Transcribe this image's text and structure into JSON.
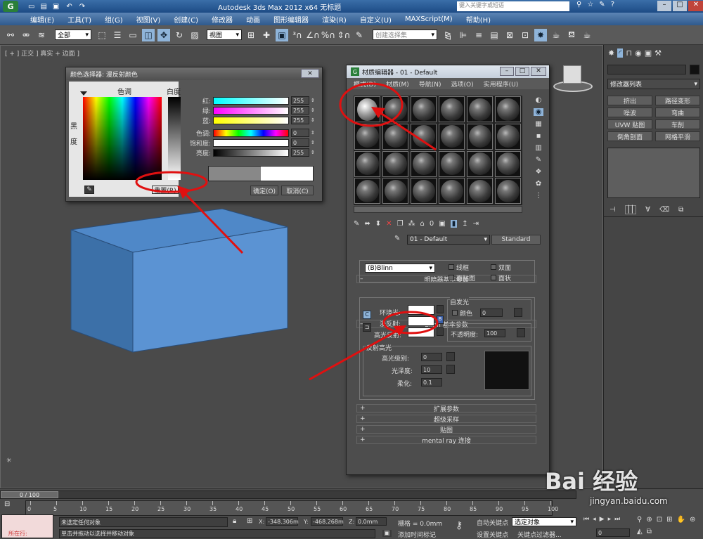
{
  "app": {
    "title": "Autodesk 3ds Max  2012 x64     无标题",
    "search_placeholder": "键入关键字或短语"
  },
  "menu": [
    "编辑(E)",
    "工具(T)",
    "组(G)",
    "视图(V)",
    "创建(C)",
    "修改器",
    "动画",
    "图形编辑器",
    "渲染(R)",
    "自定义(U)",
    "MAXScript(M)",
    "帮助(H)"
  ],
  "toolbar": {
    "filter": "全部",
    "view": "视图",
    "selection_set": "创建选择集"
  },
  "viewport": {
    "label": "[ + ] 正交 ] 真实 + 边面 ]"
  },
  "color_picker": {
    "title": "颜色选择器: 漫反射颜色",
    "hue_label": "色调",
    "white_label": "白度",
    "black_label": "黑\n度",
    "reset": "重置(R)",
    "ok": "确定(O)",
    "cancel": "取消(C)",
    "channels": [
      {
        "label": "红:",
        "value": "255",
        "color": "#f2f2ff"
      },
      {
        "label": "绿:",
        "value": "255",
        "color": "#ff60ff"
      },
      {
        "label": "蓝:",
        "value": "255",
        "color": "#ffff60"
      },
      {
        "label": "色调:",
        "value": "0"
      },
      {
        "label": "饱和度:",
        "value": "0"
      },
      {
        "label": "亮度:",
        "value": "255"
      }
    ]
  },
  "mat_editor": {
    "title": "材质编辑器 - 01 - Default",
    "menu": [
      "模式(D)",
      "材质(M)",
      "导航(N)",
      "选项(O)",
      "实用程序(U)"
    ],
    "mat_name": "01 - Default",
    "mat_type": "Standard",
    "shader_rollout": "明暗器基本参数",
    "shader": "(B)Blinn",
    "wire": "线框",
    "two_sided": "双面",
    "face_map": "面贴图",
    "faceted": "面状",
    "blinn_rollout": "Blinn 基本参数",
    "ambient": "环境光:",
    "diffuse": "漫反射:",
    "specular": "高光反射:",
    "self_illum": "自发光",
    "color": "颜色",
    "self_illum_value": "0",
    "opacity": "不透明度:",
    "opacity_value": "100",
    "spec_group": "反射高光",
    "spec_level": "高光级别:",
    "spec_level_value": "0",
    "gloss": "光泽度:",
    "gloss_value": "10",
    "soften": "柔化:",
    "soften_value": "0.1",
    "rollouts": [
      "扩展参数",
      "超级采样",
      "贴图",
      "mental ray 连接"
    ]
  },
  "cmd_panel": {
    "modifier_list": "修改器列表",
    "buttons": [
      "挤出",
      "路径变形",
      "噪波",
      "弯曲",
      "UVW 贴图",
      "车削",
      "倒角剖面",
      "网格平滑"
    ]
  },
  "timeline": {
    "frame": "0 / 100",
    "ticks": [
      "0",
      "5",
      "10",
      "15",
      "20",
      "25",
      "30",
      "35",
      "40",
      "45",
      "50",
      "55",
      "60",
      "65",
      "70",
      "75",
      "80",
      "85",
      "90",
      "95",
      "100"
    ]
  },
  "status": {
    "selection": "未选定任何对象",
    "prompt": "单击并拖动以选择并移动对象",
    "script": "所在行:",
    "x": "-348.306m",
    "y": "-468.268m",
    "z": "0.0mm",
    "grid": "栅格 = 0.0mm",
    "add_time_tag": "添加时间标记",
    "auto_key": "自动关键点",
    "set_key": "设置关键点",
    "selected": "选定对象",
    "key_filter": "关键点过滤器...",
    "frame": "0"
  },
  "watermark": {
    "text": "Bai 经验",
    "url": "jingyan.baidu.com"
  }
}
